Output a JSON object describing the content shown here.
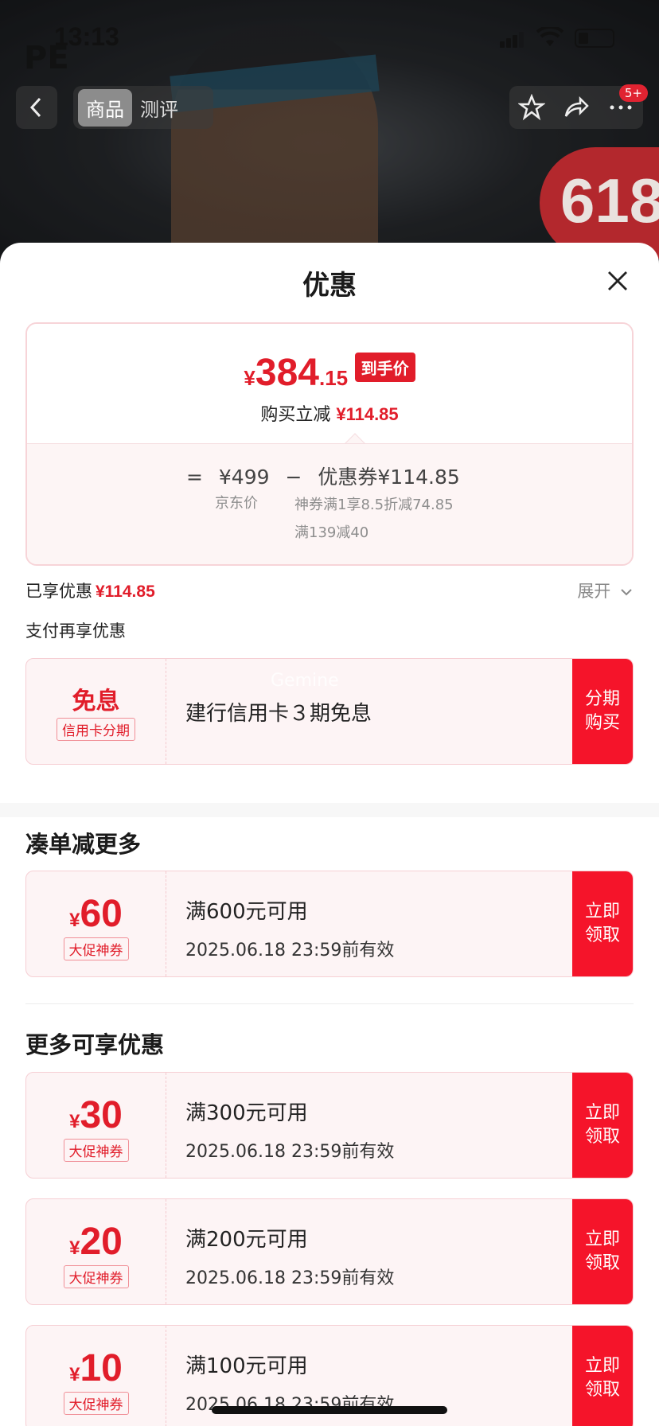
{
  "status_bar": {
    "time": "13:13"
  },
  "nav": {
    "tabs": [
      "商品",
      "测评"
    ],
    "badge": "5+"
  },
  "hero": {
    "promo_badge": "618",
    "brand_logo": "PE"
  },
  "sheet": {
    "title": "优惠",
    "final_price": {
      "currency": "¥",
      "integer": "384",
      "decimal": ".15",
      "tag": "到手价"
    },
    "reduce": {
      "label": "购买立减",
      "amount": "¥114.85"
    },
    "formula": {
      "equals": "=",
      "base_price": "¥499",
      "minus": "−",
      "coupon_label": "优惠券¥114.85",
      "base_caption": "京东价",
      "coupon_detail_1": "神券满1享8.5折减74.85",
      "coupon_detail_2": "满139减40"
    },
    "enjoyed": {
      "label": "已享优惠",
      "amount": "¥114.85",
      "expand": "展开"
    },
    "pay_section_title": "支付再享优惠",
    "installment": {
      "title": "免息",
      "tag": "信用卡分期",
      "desc": "建行信用卡３期免息",
      "button": "分期购买",
      "watermark": "Gemine"
    },
    "bundle_title": "凑单减更多",
    "more_title": "更多可享优惠",
    "coupons": [
      {
        "currency": "¥",
        "amount": "60",
        "tag": "大促神券",
        "condition": "满600元可用",
        "valid": "2025.06.18 23:59前有效",
        "button": "立即领取"
      },
      {
        "currency": "¥",
        "amount": "30",
        "tag": "大促神券",
        "condition": "满300元可用",
        "valid": "2025.06.18 23:59前有效",
        "button": "立即领取"
      },
      {
        "currency": "¥",
        "amount": "20",
        "tag": "大促神券",
        "condition": "满200元可用",
        "valid": "2025.06.18 23:59前有效",
        "button": "立即领取"
      },
      {
        "currency": "¥",
        "amount": "10",
        "tag": "大促神券",
        "condition": "满100元可用",
        "valid": "2025.06.18 23:59前有效",
        "button": "立即领取"
      }
    ]
  },
  "colors": {
    "accent": "#e11d2a",
    "button": "#f5142a",
    "border": "#f6cfd4"
  }
}
